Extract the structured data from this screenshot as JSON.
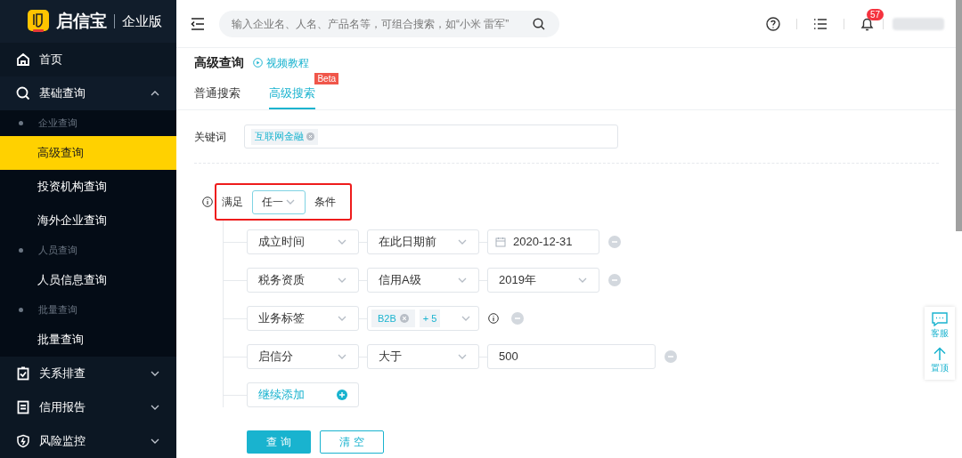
{
  "brand": {
    "name": "启信宝",
    "edition": "企业版"
  },
  "sidebar": {
    "items": [
      {
        "label": "首页",
        "kind": "top"
      },
      {
        "label": "基础查询",
        "kind": "group",
        "expanded": true,
        "children": [
          {
            "label": "企业查询",
            "kind": "section"
          },
          {
            "label": "高级查询",
            "kind": "link",
            "selected": true
          },
          {
            "label": "投资机构查询",
            "kind": "link",
            "selected": false
          },
          {
            "label": "海外企业查询",
            "kind": "link",
            "selected": false
          },
          {
            "label": "人员查询",
            "kind": "section"
          },
          {
            "label": "人员信息查询",
            "kind": "link",
            "selected": false
          },
          {
            "label": "批量查询",
            "kind": "section"
          },
          {
            "label": "批量查询",
            "kind": "link",
            "selected": false
          }
        ]
      },
      {
        "label": "关系排查",
        "kind": "group",
        "expanded": false
      },
      {
        "label": "信用报告",
        "kind": "group",
        "expanded": false
      },
      {
        "label": "风险监控",
        "kind": "group",
        "expanded": false
      }
    ]
  },
  "topbar": {
    "search_placeholder": "输入企业名、人名、产品名等，可组合搜索，如“小米 雷军”",
    "notification_count": "57"
  },
  "page": {
    "title": "高级查询",
    "video_link": "视频教程"
  },
  "tabs": [
    {
      "label": "普通搜索",
      "selected": false
    },
    {
      "label": "高级搜索",
      "selected": true,
      "badge": "Beta"
    }
  ],
  "keyword": {
    "label": "关键词",
    "tags": [
      "互联网金融"
    ]
  },
  "match": {
    "prefix": "满足",
    "value": "任一",
    "suffix": "条件"
  },
  "conditions": [
    {
      "field": "成立时间",
      "operator": "在此日期前",
      "kind": "date",
      "value": "2020-12-31",
      "info": false
    },
    {
      "field": "税务资质",
      "operator": "信用A级",
      "kind": "select",
      "value": "2019年",
      "info": false
    },
    {
      "field": "业务标签",
      "kind": "tags",
      "tags": [
        "B2B"
      ],
      "more": "+ 5",
      "info": true
    },
    {
      "field": "启信分",
      "operator": "大于",
      "kind": "text",
      "value": "500",
      "info": false
    }
  ],
  "add_condition": "继续添加",
  "buttons": {
    "query": "查 询",
    "clear": "清 空"
  },
  "float_panel": [
    "客服",
    "置顶"
  ]
}
